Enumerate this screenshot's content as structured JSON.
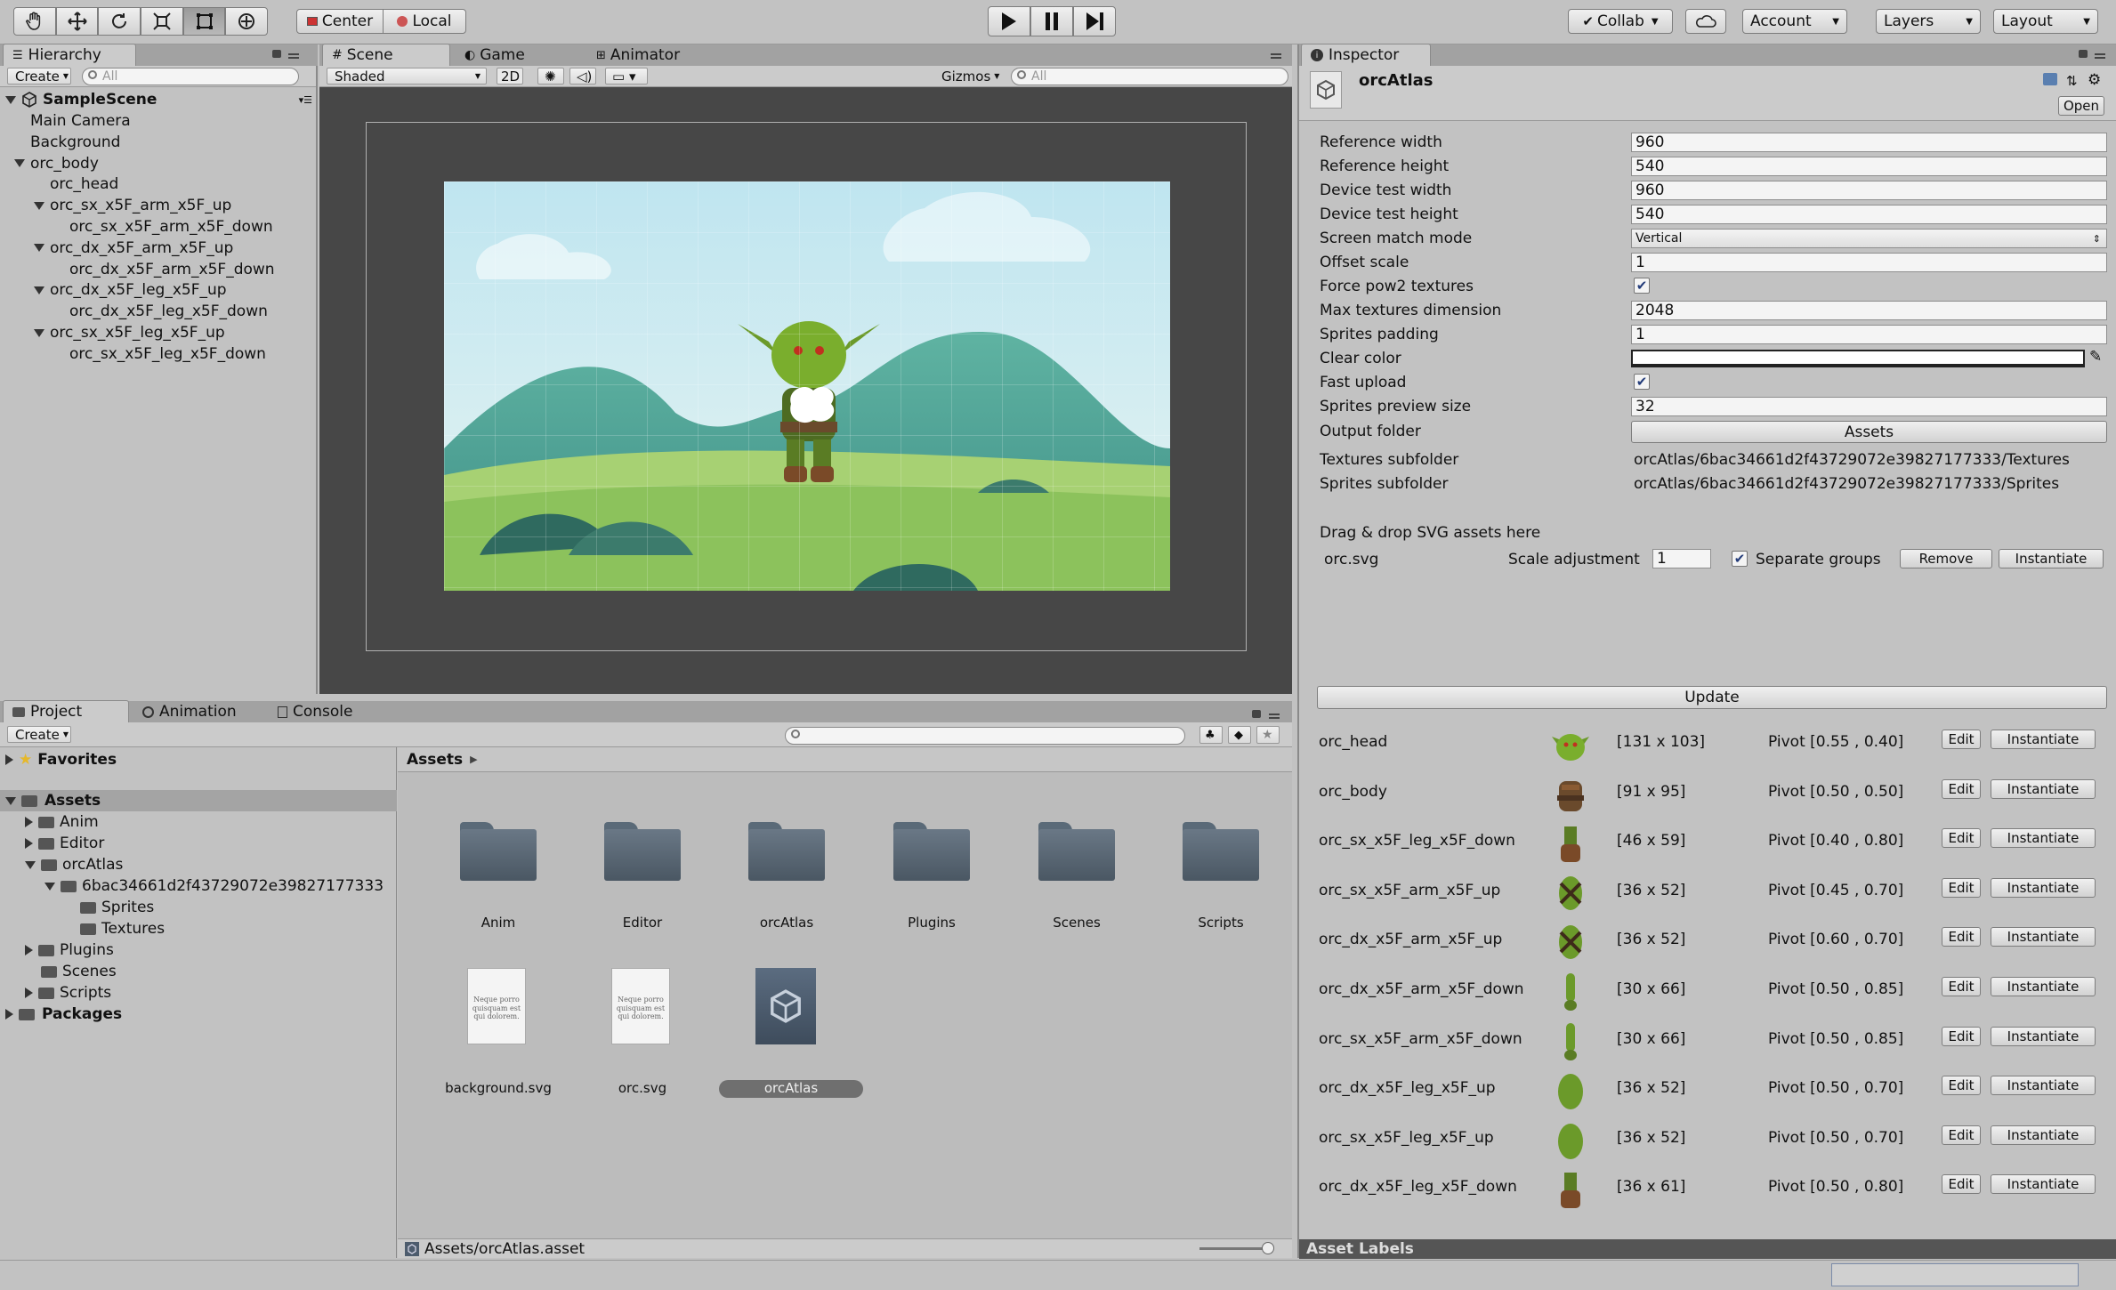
{
  "toolbar": {
    "tools": [
      "hand-tool-icon",
      "move-tool-icon",
      "rotate-tool-icon",
      "scale-tool-icon",
      "rect-tool-icon",
      "transform-tool-icon"
    ],
    "pivot_center": "Center",
    "pivot_local": "Local",
    "collab": "Collab",
    "account": "Account",
    "layers": "Layers",
    "layout": "Layout"
  },
  "hierarchy": {
    "tab": "Hierarchy",
    "create": "Create",
    "search_placeholder": "All",
    "scene": "SampleScene",
    "items": [
      {
        "label": "Main Camera",
        "indent": 1,
        "arrow": "none"
      },
      {
        "label": "Background",
        "indent": 1,
        "arrow": "none"
      },
      {
        "label": "orc_body",
        "indent": 1,
        "arrow": "down"
      },
      {
        "label": "orc_head",
        "indent": 2,
        "arrow": "none"
      },
      {
        "label": "orc_sx_x5F_arm_x5F_up",
        "indent": 2,
        "arrow": "down"
      },
      {
        "label": "orc_sx_x5F_arm_x5F_down",
        "indent": 3,
        "arrow": "none"
      },
      {
        "label": "orc_dx_x5F_arm_x5F_up",
        "indent": 2,
        "arrow": "down"
      },
      {
        "label": "orc_dx_x5F_arm_x5F_down",
        "indent": 3,
        "arrow": "none"
      },
      {
        "label": "orc_dx_x5F_leg_x5F_up",
        "indent": 2,
        "arrow": "down"
      },
      {
        "label": "orc_dx_x5F_leg_x5F_down",
        "indent": 3,
        "arrow": "none"
      },
      {
        "label": "orc_sx_x5F_leg_x5F_up",
        "indent": 2,
        "arrow": "down"
      },
      {
        "label": "orc_sx_x5F_leg_x5F_down",
        "indent": 3,
        "arrow": "none"
      }
    ]
  },
  "scene_view": {
    "tabs": [
      "Scene",
      "Game",
      "Animator"
    ],
    "shading": "Shaded",
    "mode_2d": "2D",
    "gizmos": "Gizmos",
    "search_placeholder": "All"
  },
  "project": {
    "tabs": [
      "Project",
      "Animation",
      "Console"
    ],
    "create": "Create",
    "favorites": "Favorites",
    "assets_root": "Assets",
    "packages": "Packages",
    "tree": [
      {
        "label": "Anim",
        "indent": 1,
        "arrow": "right"
      },
      {
        "label": "Editor",
        "indent": 1,
        "arrow": "right"
      },
      {
        "label": "orcAtlas",
        "indent": 1,
        "arrow": "down"
      },
      {
        "label": "6bac34661d2f43729072e39827177333",
        "indent": 2,
        "arrow": "down"
      },
      {
        "label": "Sprites",
        "indent": 3,
        "arrow": "none"
      },
      {
        "label": "Textures",
        "indent": 3,
        "arrow": "none"
      },
      {
        "label": "Plugins",
        "indent": 1,
        "arrow": "right"
      },
      {
        "label": "Scenes",
        "indent": 1,
        "arrow": "none"
      },
      {
        "label": "Scripts",
        "indent": 1,
        "arrow": "right"
      }
    ],
    "breadcrumb": "Assets",
    "folders": [
      "Anim",
      "Editor",
      "orcAtlas",
      "Plugins",
      "Scenes",
      "Scripts"
    ],
    "files": [
      {
        "label": "background.svg",
        "kind": "svg",
        "preview": "Neque porro quisquam est qui dolorem."
      },
      {
        "label": "orc.svg",
        "kind": "svg",
        "preview": "Neque porro quisquam est qui dolorem."
      },
      {
        "label": "orcAtlas",
        "kind": "unity",
        "selected": true
      }
    ],
    "status_path": "Assets/orcAtlas.asset"
  },
  "inspector": {
    "tab": "Inspector",
    "asset_name": "orcAtlas",
    "open": "Open",
    "fields": {
      "reference_width": {
        "label": "Reference width",
        "value": "960"
      },
      "reference_height": {
        "label": "Reference height",
        "value": "540"
      },
      "device_test_width": {
        "label": "Device test width",
        "value": "960"
      },
      "device_test_height": {
        "label": "Device test height",
        "value": "540"
      },
      "screen_match_mode": {
        "label": "Screen match mode",
        "value": "Vertical"
      },
      "offset_scale": {
        "label": "Offset scale",
        "value": "1"
      },
      "force_pow2": {
        "label": "Force pow2 textures",
        "checked": true
      },
      "max_textures_dimension": {
        "label": "Max textures dimension",
        "value": "2048"
      },
      "sprites_padding": {
        "label": "Sprites padding",
        "value": "1"
      },
      "clear_color": {
        "label": "Clear color",
        "value": "#ffffff"
      },
      "fast_upload": {
        "label": "Fast upload",
        "checked": true
      },
      "sprites_preview_size": {
        "label": "Sprites preview size",
        "value": "32"
      },
      "output_folder": {
        "label": "Output folder",
        "value": "Assets"
      },
      "textures_subfolder": {
        "label": "Textures subfolder",
        "value": "orcAtlas/6bac34661d2f43729072e39827177333/Textures"
      },
      "sprites_subfolder": {
        "label": "Sprites subfolder",
        "value": "orcAtlas/6bac34661d2f43729072e39827177333/Sprites"
      }
    },
    "drag_drop": "Drag & drop SVG assets here",
    "svg_entry": {
      "file": "orc.svg",
      "scale_label": "Scale adjustment",
      "scale_value": "1",
      "separate_groups": "Separate groups",
      "remove": "Remove",
      "instantiate": "Instantiate"
    },
    "update": "Update",
    "sprites": [
      {
        "name": "orc_head",
        "size": "[131 x 103]",
        "pivot": "Pivot [0.55 , 0.40]",
        "thumb": "head"
      },
      {
        "name": "orc_body",
        "size": "[91 x 95]",
        "pivot": "Pivot [0.50 , 0.50]",
        "thumb": "body"
      },
      {
        "name": "orc_sx_x5F_leg_x5F_down",
        "size": "[46 x 59]",
        "pivot": "Pivot [0.40 , 0.80]",
        "thumb": "legdown"
      },
      {
        "name": "orc_sx_x5F_arm_x5F_up",
        "size": "[36 x 52]",
        "pivot": "Pivot [0.45 , 0.70]",
        "thumb": "armup"
      },
      {
        "name": "orc_dx_x5F_arm_x5F_up",
        "size": "[36 x 52]",
        "pivot": "Pivot [0.60 , 0.70]",
        "thumb": "armup"
      },
      {
        "name": "orc_dx_x5F_arm_x5F_down",
        "size": "[30 x 66]",
        "pivot": "Pivot [0.50 , 0.85]",
        "thumb": "armdown"
      },
      {
        "name": "orc_sx_x5F_arm_x5F_down",
        "size": "[30 x 66]",
        "pivot": "Pivot [0.50 , 0.85]",
        "thumb": "armdown"
      },
      {
        "name": "orc_dx_x5F_leg_x5F_up",
        "size": "[36 x 52]",
        "pivot": "Pivot [0.50 , 0.70]",
        "thumb": "legup"
      },
      {
        "name": "orc_sx_x5F_leg_x5F_up",
        "size": "[36 x 52]",
        "pivot": "Pivot [0.50 , 0.70]",
        "thumb": "legup"
      },
      {
        "name": "orc_dx_x5F_leg_x5F_down",
        "size": "[36 x 61]",
        "pivot": "Pivot [0.50 , 0.80]",
        "thumb": "legdown"
      }
    ],
    "sprite_edit": "Edit",
    "sprite_instantiate": "Instantiate",
    "asset_labels": "Asset Labels"
  }
}
